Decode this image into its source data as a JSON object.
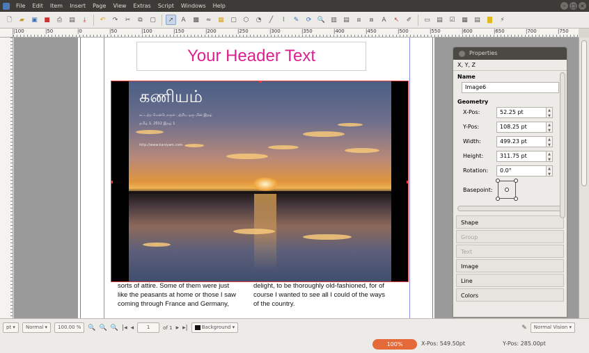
{
  "menubar": {
    "items": [
      "File",
      "Edit",
      "Item",
      "Insert",
      "Page",
      "View",
      "Extras",
      "Script",
      "Windows",
      "Help"
    ]
  },
  "ruler": {
    "labels": [
      "|100",
      "|50",
      "|0",
      "|50",
      "|100",
      "|150",
      "|200",
      "|250",
      "|300",
      "|350",
      "|400",
      "|450",
      "|500",
      "|550",
      "|600",
      "|650",
      "|700",
      "|750"
    ]
  },
  "document": {
    "header_text": "Your Header Text",
    "overlay_title": "கணியம்",
    "overlay_line1": "கட்டற்ற மென்பொருள் பற்றிய ஒரு மின் இதழ்",
    "overlay_line2": "தமிழ் 1, 2012 இதழ் 1",
    "overlay_line3": "http://www.kaniyam.com",
    "column1": [
      "sorts of attire. Some of them were just",
      "like the peasants at home or those I saw",
      "coming through France and Germany,"
    ],
    "column2": [
      "delight, to be thoroughly old-fashioned, for of",
      "course I wanted to see all I could of the ways",
      "of the country."
    ]
  },
  "properties": {
    "title": "Properties",
    "tab_xyz": "X, Y, Z",
    "name_label": "Name",
    "name_value": "Image6",
    "geometry_label": "Geometry",
    "geometry": [
      {
        "label": "X-Pos:",
        "value": "52.25 pt"
      },
      {
        "label": "Y-Pos:",
        "value": "108.25 pt"
      },
      {
        "label": "Width:",
        "value": "499.23 pt"
      },
      {
        "label": "Height:",
        "value": "311.75 pt"
      },
      {
        "label": "Rotation:",
        "value": "0.0°"
      }
    ],
    "basepoint_label": "Basepoint:",
    "sections": [
      {
        "label": "Shape",
        "enabled": true
      },
      {
        "label": "Group",
        "enabled": false
      },
      {
        "label": "Text",
        "enabled": false
      },
      {
        "label": "Image",
        "enabled": true
      },
      {
        "label": "Line",
        "enabled": true
      },
      {
        "label": "Colors",
        "enabled": true
      }
    ]
  },
  "statusbar": {
    "unit": "pt",
    "mode": "Normal",
    "zoom": "100.00 %",
    "page_current": "1",
    "page_of": "of 1",
    "layer": "Background",
    "vision": "Normal Vision"
  },
  "footer": {
    "zoom_pill": "100%",
    "xpos": "X-Pos: 549.50pt",
    "ypos": "Y-Pos: 285.00pt"
  },
  "colors": {
    "header_text": "#dd1f8f",
    "zoom_pill": "#e46a3a",
    "selection_frame": "#e53c3c"
  }
}
